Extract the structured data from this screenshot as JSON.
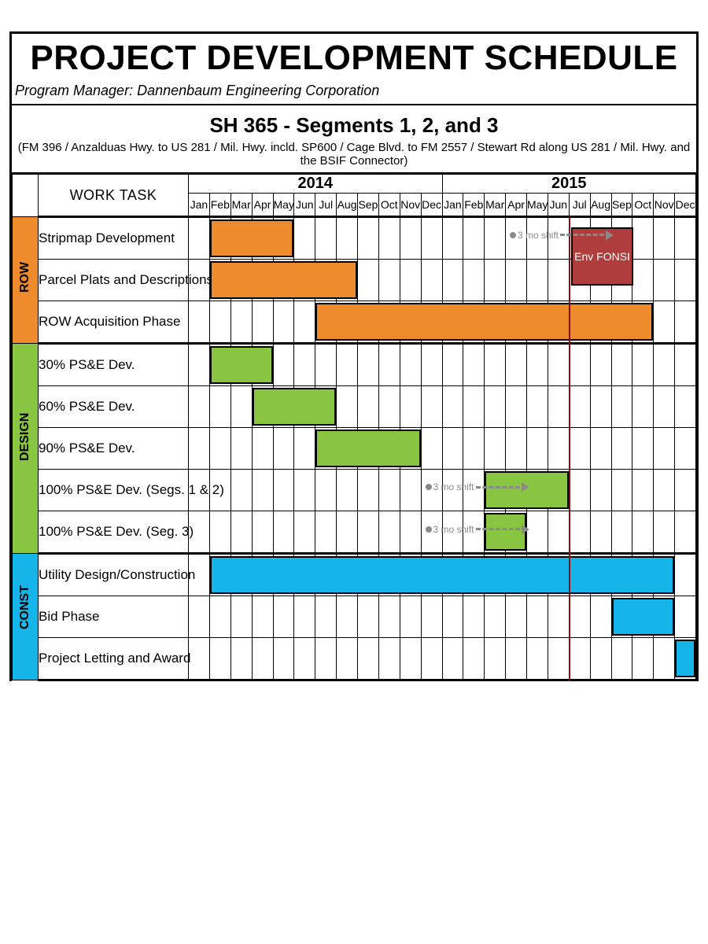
{
  "title": "PROJECT DEVELOPMENT SCHEDULE",
  "pm_line": "Program Manager: Dannenbaum Engineering Corporation",
  "subtitle": "SH 365 - Segments 1, 2, and 3",
  "desc": "(FM 396 / Anzalduas Hwy. to US 281 / Mil. Hwy. incld. SP600 / Cage Blvd. to FM 2557 / Stewart Rd along US 281 / Mil. Hwy. and the BSIF Connector)",
  "worktask_header": "WORK TASK",
  "years": [
    "2014",
    "2015"
  ],
  "months": [
    "Jan",
    "Feb",
    "Mar",
    "Apr",
    "May",
    "Jun",
    "Jul",
    "Aug",
    "Sep",
    "Oct",
    "Nov",
    "Dec",
    "Jan",
    "Feb",
    "Mar",
    "Apr",
    "May",
    "Jun",
    "Jul",
    "Aug",
    "Sep",
    "Oct",
    "Nov",
    "Dec"
  ],
  "sections": [
    {
      "label": "ROW",
      "color": "#ee8b2c",
      "tasks": [
        "Stripmap Development",
        "Parcel Plats and Descriptions",
        "ROW Acquisition Phase"
      ]
    },
    {
      "label": "DESIGN",
      "color": "#88c540",
      "tasks": [
        "30% PS&E Dev.",
        "60% PS&E Dev.",
        "90% PS&E Dev.",
        "100% PS&E Dev. (Segs. 1 & 2)",
        "100% PS&E Dev. (Seg. 3)"
      ]
    },
    {
      "label": "CONST",
      "color": "#16b5e9",
      "tasks": [
        "Utility Design/Construction",
        "Bid Phase",
        "Project Letting and Award"
      ]
    }
  ],
  "env_fonsi_label": "Env FONSI",
  "shift_label": "3 mo shift",
  "chart_data": {
    "type": "gantt",
    "title": "PROJECT DEVELOPMENT SCHEDULE — SH 365 Segments 1, 2, and 3",
    "x": {
      "start": "2014-01",
      "end": "2015-12",
      "unit": "month",
      "categories": [
        "2014-01",
        "2014-02",
        "2014-03",
        "2014-04",
        "2014-05",
        "2014-06",
        "2014-07",
        "2014-08",
        "2014-09",
        "2014-10",
        "2014-11",
        "2014-12",
        "2015-01",
        "2015-02",
        "2015-03",
        "2015-04",
        "2015-05",
        "2015-06",
        "2015-07",
        "2015-08",
        "2015-09",
        "2015-10",
        "2015-11",
        "2015-12"
      ]
    },
    "series": [
      {
        "group": "ROW",
        "name": "Stripmap Development",
        "start": 2,
        "end": 5,
        "color": "#ee8b2c"
      },
      {
        "group": "ROW",
        "name": "Parcel Plats and Descriptions",
        "start": 2,
        "end": 8,
        "color": "#ee8b2c"
      },
      {
        "group": "ROW",
        "name": "ROW Acquisition Phase",
        "start": 7,
        "end": 22,
        "color": "#ee8b2c"
      },
      {
        "group": "DESIGN",
        "name": "30% PS&E Dev.",
        "start": 2,
        "end": 4,
        "color": "#88c540"
      },
      {
        "group": "DESIGN",
        "name": "60% PS&E Dev.",
        "start": 4,
        "end": 7,
        "color": "#88c540"
      },
      {
        "group": "DESIGN",
        "name": "90% PS&E Dev.",
        "start": 7,
        "end": 11,
        "color": "#88c540"
      },
      {
        "group": "DESIGN",
        "name": "100% PS&E Dev. (Segs. 1 & 2)",
        "start": 15,
        "end": 18,
        "color": "#88c540",
        "note": "3 mo shift"
      },
      {
        "group": "DESIGN",
        "name": "100% PS&E Dev. (Seg. 3)",
        "start": 15,
        "end": 16,
        "color": "#88c540",
        "note": "3 mo shift"
      },
      {
        "group": "CONST",
        "name": "Utility Design/Construction",
        "start": 2,
        "end": 23,
        "color": "#16b5e9"
      },
      {
        "group": "CONST",
        "name": "Bid Phase",
        "start": 21,
        "end": 23,
        "color": "#16b5e9"
      },
      {
        "group": "CONST",
        "name": "Project Letting and Award",
        "start": 24,
        "end": 24,
        "color": "#16b5e9"
      }
    ],
    "milestones": [
      {
        "name": "Env FONSI",
        "start": 19,
        "end": 21,
        "color": "#af3d3b",
        "note": "3 mo shift"
      }
    ],
    "reference_lines": [
      {
        "month": 19,
        "color": "#8a0e0e"
      }
    ]
  }
}
